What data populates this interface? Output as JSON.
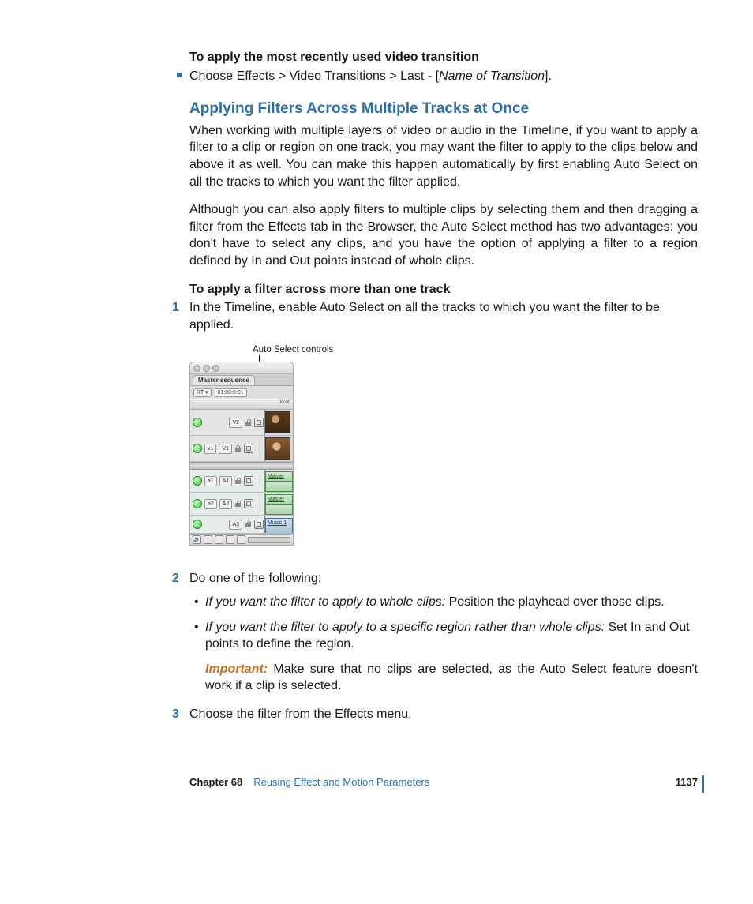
{
  "section1": {
    "heading": "To apply the most recently used video transition",
    "bullet_pre": "Choose Effects > Video Transitions > Last - [",
    "bullet_italic": "Name of Transition",
    "bullet_post": "]."
  },
  "section2": {
    "heading": "Applying Filters Across Multiple Tracks at Once",
    "para1": "When working with multiple layers of video or audio in the Timeline, if you want to apply a filter to a clip or region on one track, you may want the filter to apply to the clips below and above it as well. You can make this happen automatically by first enabling Auto Select on all the tracks to which you want the filter applied.",
    "para2": "Although you can also apply filters to multiple clips by selecting them and then dragging a filter from the Effects tab in the Browser, the Auto Select method has two advantages: you don't have to select any clips, and you have the option of applying a filter to a region defined by In and Out points instead of whole clips."
  },
  "section3": {
    "heading": "To apply a filter across more than one track",
    "step1": "In the Timeline, enable Auto Select on all the tracks to which you want the filter to be applied.",
    "callout": "Auto Select controls",
    "step2": "Do one of the following:",
    "opt_a_italic": "If you want the filter to apply to whole clips:",
    "opt_a_rest": "  Position the playhead over those clips.",
    "opt_b_italic": "If you want the filter to apply to a specific region rather than whole clips:",
    "opt_b_rest": "  Set In and Out points to define the region.",
    "important_label": "Important:",
    "important_rest": "  Make sure that no clips are selected, as the Auto Select feature doesn't work if a clip is selected.",
    "step3": "Choose the filter from the Effects menu."
  },
  "timeline": {
    "tab": "Master sequence",
    "rt": "RT ▾",
    "timecode": "01:00:0:01",
    "ruler": "00:00",
    "v2": "V2",
    "v1src": "v1",
    "v1": "V1",
    "a1src": "a1",
    "a1": "A1",
    "a2src": "a2",
    "a2": "A2",
    "a3": "A3",
    "clip_master": "Master sh",
    "clip_music": "Music 1"
  },
  "footer": {
    "chapter": "Chapter 68",
    "title": "Reusing Effect and Motion Parameters",
    "page": "1137"
  }
}
